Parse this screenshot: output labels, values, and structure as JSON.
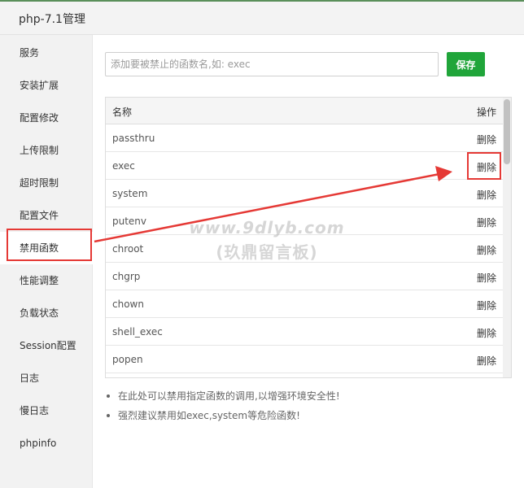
{
  "window": {
    "title": "php-7.1管理"
  },
  "sidebar": {
    "items": [
      {
        "label": "服务"
      },
      {
        "label": "安装扩展"
      },
      {
        "label": "配置修改"
      },
      {
        "label": "上传限制"
      },
      {
        "label": "超时限制"
      },
      {
        "label": "配置文件"
      },
      {
        "label": "禁用函数"
      },
      {
        "label": "性能调整"
      },
      {
        "label": "负载状态"
      },
      {
        "label": "Session配置"
      },
      {
        "label": "日志"
      },
      {
        "label": "慢日志"
      },
      {
        "label": "phpinfo"
      }
    ],
    "active_index": 6
  },
  "form": {
    "placeholder": "添加要被禁止的函数名,如: exec",
    "value": "",
    "save_label": "保存"
  },
  "table": {
    "headers": {
      "name": "名称",
      "action": "操作"
    },
    "rows": [
      {
        "name": "passthru",
        "action": "删除"
      },
      {
        "name": "exec",
        "action": "删除"
      },
      {
        "name": "system",
        "action": "删除"
      },
      {
        "name": "putenv",
        "action": "删除"
      },
      {
        "name": "chroot",
        "action": "删除"
      },
      {
        "name": "chgrp",
        "action": "删除"
      },
      {
        "name": "chown",
        "action": "删除"
      },
      {
        "name": "shell_exec",
        "action": "删除"
      },
      {
        "name": "popen",
        "action": "删除"
      }
    ]
  },
  "tips": [
    "在此处可以禁用指定函数的调用,以增强环境安全性!",
    "强烈建议禁用如exec,system等危险函数!"
  ],
  "watermark": {
    "line1": "www.9dlyb.com",
    "line2": "(玖鼎留言板)"
  },
  "colors": {
    "accent": "#20a53a",
    "annotation": "#e53935"
  }
}
